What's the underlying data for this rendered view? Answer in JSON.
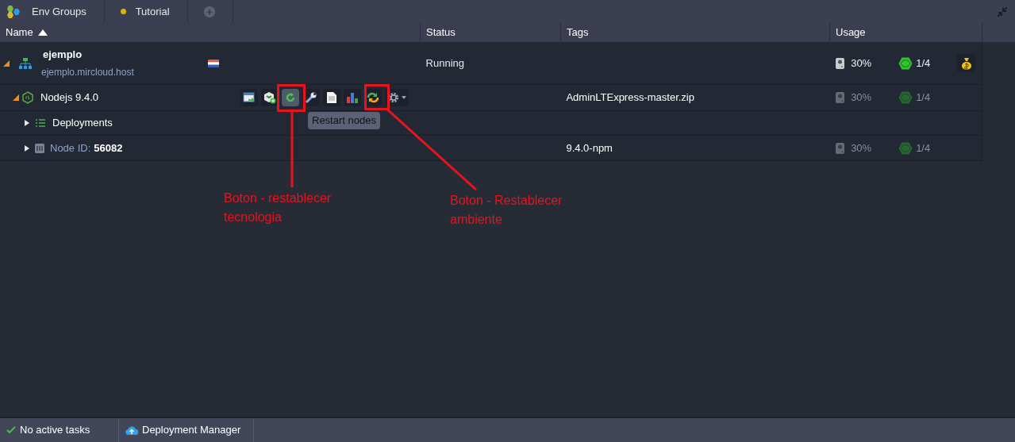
{
  "breadcrumbs": [
    {
      "kind": "groups",
      "label": "Env Groups"
    },
    {
      "kind": "env",
      "label": "Tutorial",
      "color": "#e0b400"
    },
    {
      "kind": "add"
    }
  ],
  "columns": [
    {
      "label": "Name",
      "sorted": true
    },
    {
      "label": "Status",
      "sorted": false
    },
    {
      "label": "Tags",
      "sorted": false
    },
    {
      "label": "Usage",
      "sorted": false
    }
  ],
  "rows": [
    {
      "kind": "env",
      "name": "ejemplo",
      "domain": "ejemplo.mircloud.host",
      "expanded": true,
      "status": "Running",
      "tags": "",
      "disk": "30%",
      "cloudlets": "1/4",
      "dimmed": false
    },
    {
      "kind": "node",
      "name": "Nodejs 9.4.0",
      "expanded": true,
      "tags": "AdminLTExpress-master.zip",
      "disk": "30%",
      "cloudlets": "1/4",
      "dimmed": true,
      "tools": [
        {
          "kind": "open",
          "selected": false
        },
        {
          "kind": "add-node",
          "selected": false
        },
        {
          "kind": "restart",
          "selected": true
        },
        {
          "kind": "config",
          "selected": false
        },
        {
          "kind": "log",
          "selected": false
        },
        {
          "kind": "stats",
          "selected": false
        },
        {
          "kind": "redeploy",
          "selected": false
        },
        {
          "kind": "settings",
          "selected": false
        }
      ],
      "tooltip": "Restart nodes"
    },
    {
      "kind": "folder",
      "name": "Deployments",
      "expanded": false
    },
    {
      "kind": "nodeid",
      "label": "Node ID:",
      "value": "56082",
      "expanded": false,
      "tags": "9.4.0-npm",
      "disk": "30%",
      "cloudlets": "1/4",
      "dimmed": true
    }
  ],
  "annotations": [
    {
      "text": "Boton - restablecer tecnologia"
    },
    {
      "text": "Boton - Restablecer ambiente"
    }
  ],
  "status_bar": [
    {
      "kind": "tasks",
      "label": "No active tasks"
    },
    {
      "kind": "deploy",
      "label": "Deployment Manager"
    }
  ]
}
